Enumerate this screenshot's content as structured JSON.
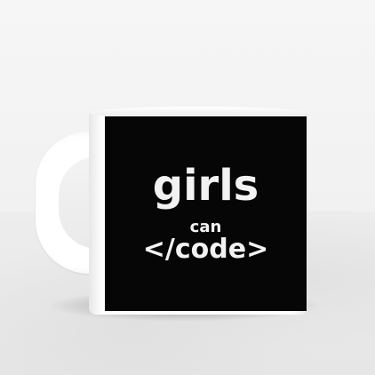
{
  "mug": {
    "print_lines": [
      "girls",
      "can",
      "</code>"
    ],
    "print_color": "#060606",
    "text_color": "#f2f2f2",
    "mug_color": "#ffffff"
  }
}
